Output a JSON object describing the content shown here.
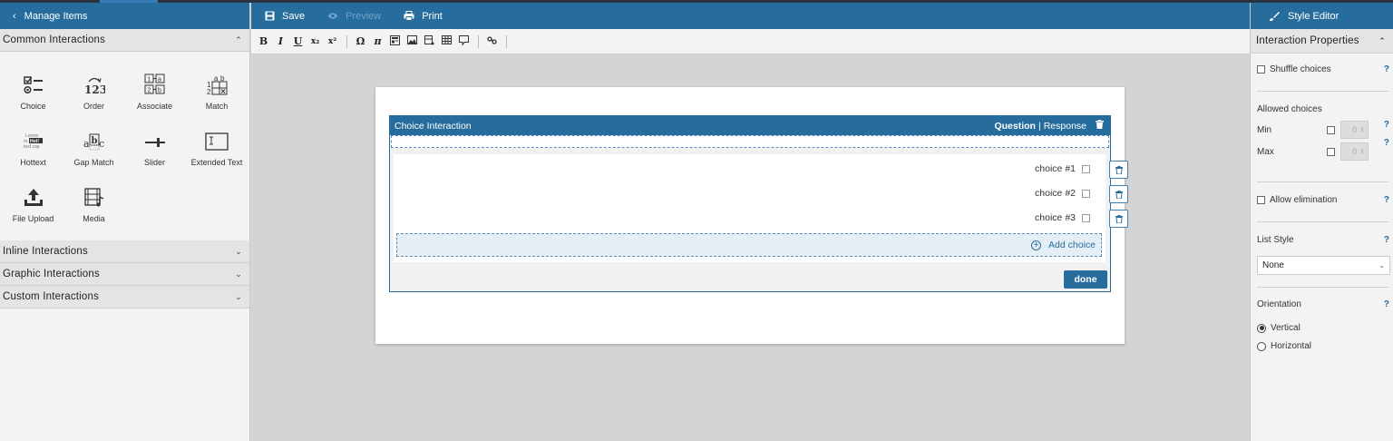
{
  "left_panel": {
    "header": "Manage Items",
    "common_section": "Common Interactions",
    "tiles": [
      {
        "label": "Choice",
        "icon": "choice-icon"
      },
      {
        "label": "Order",
        "icon": "order-icon"
      },
      {
        "label": "Associate",
        "icon": "associate-icon"
      },
      {
        "label": "Match",
        "icon": "match-icon"
      },
      {
        "label": "Hottext",
        "icon": "hottext-icon"
      },
      {
        "label": "Gap Match",
        "icon": "gap-match-icon"
      },
      {
        "label": "Slider",
        "icon": "slider-icon"
      },
      {
        "label": "Extended Text",
        "icon": "extended-text-icon"
      },
      {
        "label": "File Upload",
        "icon": "file-upload-icon"
      },
      {
        "label": "Media",
        "icon": "media-icon"
      }
    ],
    "other_sections": [
      "Inline Interactions",
      "Graphic Interactions",
      "Custom Interactions"
    ]
  },
  "toolbar": {
    "save": "Save",
    "preview": "Preview",
    "print": "Print"
  },
  "format_toolbar": [
    "B",
    "I",
    "U",
    "x₂",
    "x²",
    "Ω",
    "π"
  ],
  "interaction": {
    "title": "Choice Interaction",
    "mode_question": "Question",
    "mode_separator": "|",
    "mode_response": "Response",
    "choices": [
      "choice #1",
      "choice #2",
      "choice #3"
    ],
    "add_choice": "Add choice",
    "done": "done"
  },
  "right_panel": {
    "header": "Style Editor",
    "section": "Interaction Properties",
    "shuffle": "Shuffle choices",
    "allowed_choices": "Allowed choices",
    "min_label": "Min",
    "min_value": "0",
    "max_label": "Max",
    "max_value": "0",
    "allow_elimination": "Allow elimination",
    "list_style_label": "List Style",
    "list_style_value": "None",
    "orientation_label": "Orientation",
    "vertical": "Vertical",
    "horizontal": "Horizontal",
    "help": "?"
  },
  "colors": {
    "brand": "#266d9e",
    "canvas": "#d4d4d4"
  }
}
